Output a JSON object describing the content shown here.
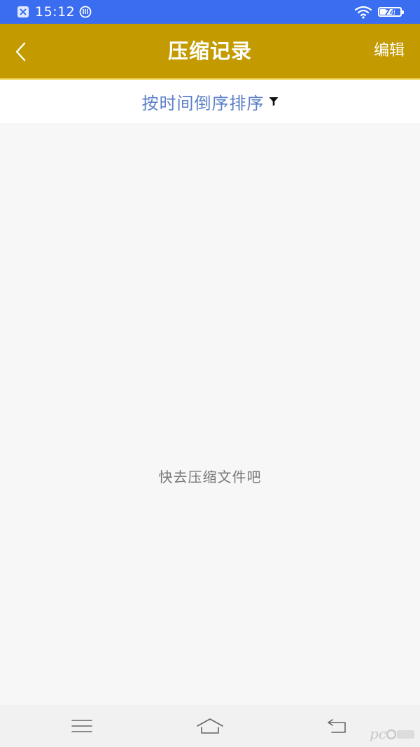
{
  "status_bar": {
    "time": "15:12",
    "battery": "74",
    "battery_level": 0.74
  },
  "header": {
    "title": "压缩记录",
    "edit_label": "编辑"
  },
  "sort": {
    "label": "按时间倒序排序"
  },
  "empty_state": {
    "message": "快去压缩文件吧"
  },
  "colors": {
    "status_bar": "#3a6df0",
    "header": "#c39a00",
    "sort_text": "#5b7fc8",
    "background": "#f7f7f7"
  },
  "icons": {
    "notification": "close-box-icon",
    "sync": "sync-icon",
    "wifi": "wifi-icon",
    "battery": "battery-icon",
    "back": "chevron-left-icon",
    "filter": "filter-icon",
    "menu": "menu-icon",
    "home": "home-icon",
    "nav_back": "return-icon",
    "watermark": "pc6-logo-icon"
  }
}
